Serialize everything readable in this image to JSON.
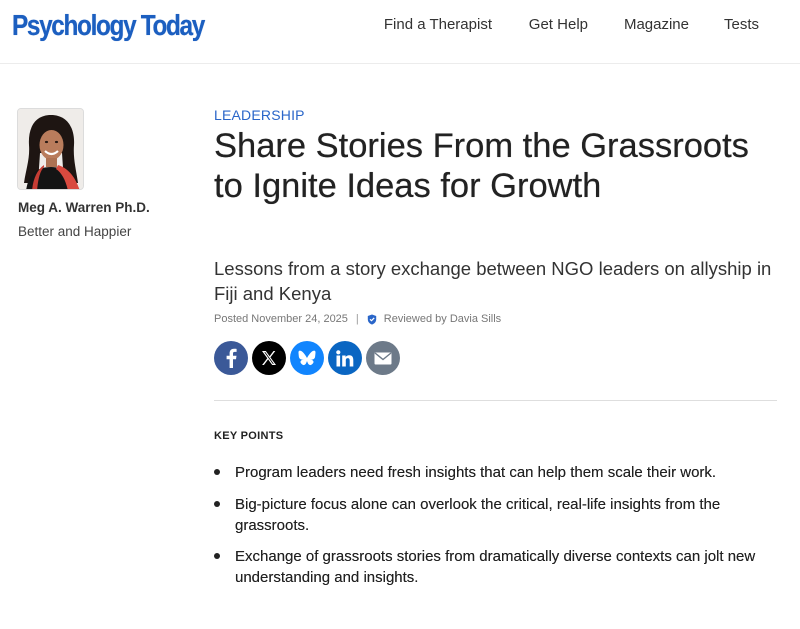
{
  "header": {
    "logo_text": "Psychology Today",
    "nav": [
      "Find a Therapist",
      "Get Help",
      "Magazine",
      "Tests"
    ]
  },
  "author": {
    "name": "Meg A. Warren Ph.D.",
    "blog": "Better and Happier"
  },
  "article": {
    "category": "LEADERSHIP",
    "title": "Share Stories From the Grassroots to Ignite Ideas for Growth",
    "subtitle": "Lessons from a story exchange between NGO leaders on allyship in Fiji and Kenya",
    "posted": "Posted November 24, 2025",
    "separator": "|",
    "reviewed": "Reviewed by Davia Sills"
  },
  "share": {
    "icons": [
      "facebook-icon",
      "x-icon",
      "bluesky-icon",
      "linkedin-icon",
      "email-icon"
    ],
    "colors": {
      "facebook": "#3b5998",
      "x": "#000000",
      "bluesky": "#1185fe",
      "linkedin": "#0a66c2",
      "email": "#6d7a89"
    }
  },
  "key_points": {
    "heading": "KEY POINTS",
    "items": [
      "Program leaders need fresh insights that can help them scale their work.",
      "Big-picture focus alone can overlook the critical, real-life insights from the grassroots.",
      "Exchange of grassroots stories from dramatically diverse contexts can jolt new understanding and insights."
    ]
  },
  "colors": {
    "brand_blue": "#1c5fc0",
    "category_blue": "#2a66c9"
  }
}
